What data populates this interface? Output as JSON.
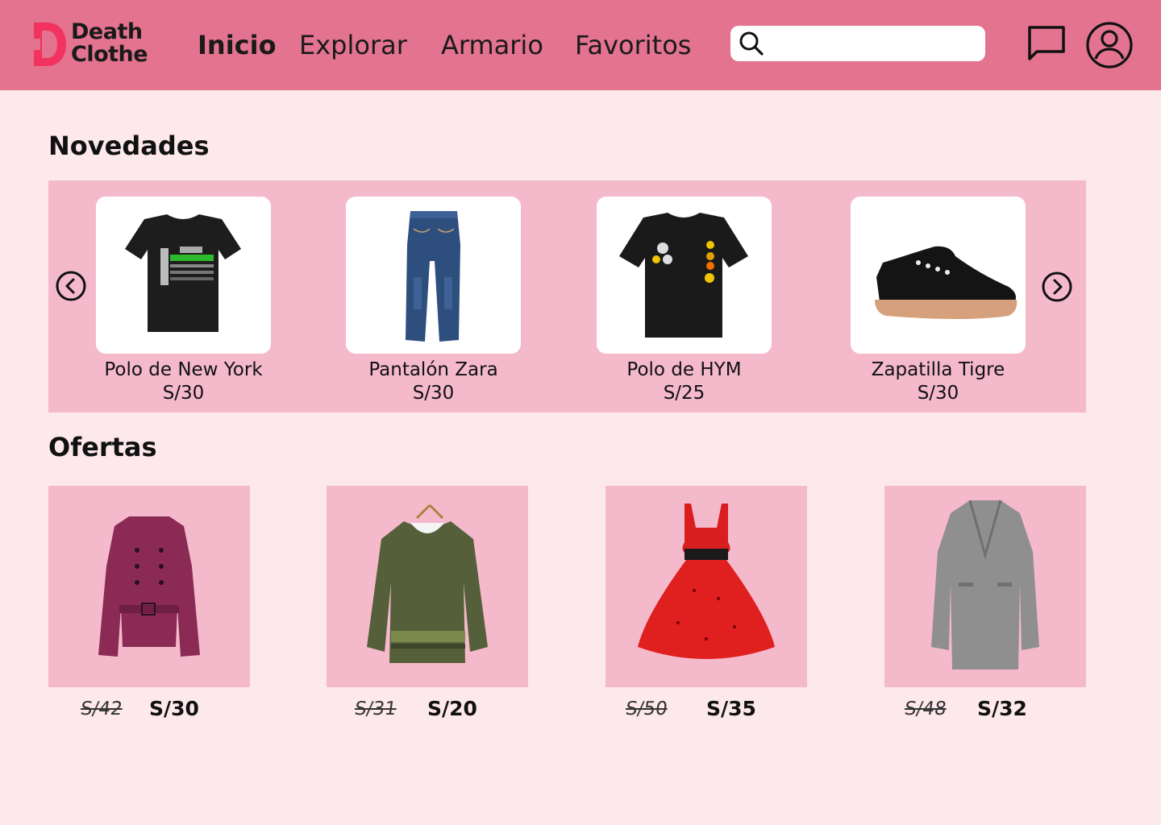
{
  "brand": {
    "line1": "Death",
    "line2": "Clothe"
  },
  "nav": [
    {
      "label": "Inicio",
      "active": true
    },
    {
      "label": "Explorar",
      "active": false
    },
    {
      "label": "Armario",
      "active": false
    },
    {
      "label": "Favoritos",
      "active": false
    }
  ],
  "search": {
    "value": "",
    "placeholder": ""
  },
  "icons": {
    "search": "search-icon",
    "chat": "chat-icon",
    "profile": "user-icon",
    "prev": "chevron-left-circle-icon",
    "next": "chevron-right-circle-icon"
  },
  "sections": {
    "new_title": "Novedades",
    "offers_title": "Ofertas"
  },
  "new_products": [
    {
      "name": "Polo de New York",
      "price": "S/30",
      "image": "black-tshirt-new-york"
    },
    {
      "name": "Pantalón Zara",
      "price": "S/30",
      "image": "blue-jeans"
    },
    {
      "name": "Polo de HYM",
      "price": "S/25",
      "image": "black-tshirt-patches"
    },
    {
      "name": "Zapatilla Tigre",
      "price": "S/30",
      "image": "black-sneaker"
    }
  ],
  "offers": [
    {
      "old_price": "S/42",
      "new_price": "S/30",
      "image": "burgundy-trench-coat"
    },
    {
      "old_price": "S/31",
      "new_price": "S/20",
      "image": "green-patterned-blouse"
    },
    {
      "old_price": "S/50",
      "new_price": "S/35",
      "image": "red-polka-dot-dress"
    },
    {
      "old_price": "S/48",
      "new_price": "S/32",
      "image": "grey-long-coat"
    }
  ],
  "colors": {
    "header": "#e3738f",
    "background": "#fde8ec",
    "panel": "#f5b9cc",
    "logo": "#f2325f"
  }
}
